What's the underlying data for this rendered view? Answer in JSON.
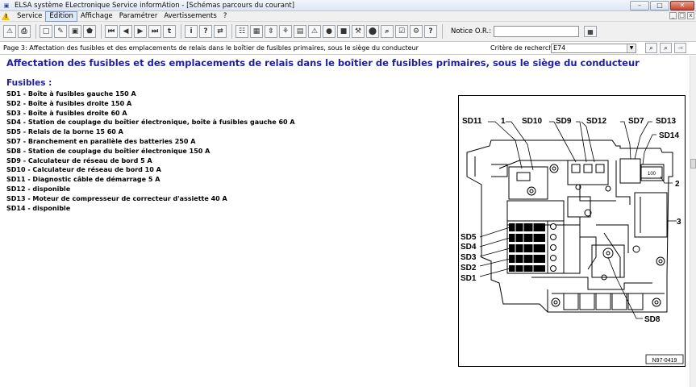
{
  "window": {
    "title": "ELSA système ELectronique Service informAtion - [Schémas parcours du courant]",
    "buttons": {
      "minimize": "–",
      "maximize": "□",
      "close": "✕"
    }
  },
  "menu": {
    "items": [
      "Service",
      "Edition",
      "Affichage",
      "Paramétrer",
      "Avertissements",
      "?"
    ],
    "active_index": 1,
    "mdi_buttons": [
      "_",
      "□",
      "x"
    ]
  },
  "toolbar": {
    "icons": [
      "exit-icon",
      "print-icon",
      "document-icon",
      "edit-icon",
      "photo-icon",
      "car-icon",
      "first-page-icon",
      "previous-page-icon",
      "next-page-icon",
      "last-page-icon",
      "back-link-icon",
      "info-icon",
      "help-icon",
      "swap-icon",
      "notes-icon",
      "grid-icon",
      "sort-icon",
      "diagnostic-icon",
      "table-icon",
      "warning-icon",
      "globe-icon",
      "save-icon",
      "wrench-icon",
      "vehicle-icon",
      "search-doc-icon",
      "checklist-icon",
      "tools-icon",
      "question-icon"
    ],
    "glyphs": [
      "⚠",
      "⎙",
      "□",
      "✎",
      "▣",
      "⬟",
      "⏮",
      "◀",
      "▶",
      "⏭",
      "t",
      "i",
      "?",
      "⇄",
      "☷",
      "▦",
      "⇳",
      "⚘",
      "▤",
      "⚠",
      "●",
      "■",
      "⚒",
      "⬤",
      "⌕",
      "☑",
      "⚙",
      "?"
    ],
    "notice_label": "Notice O.R.:",
    "notice_value": ""
  },
  "pagebar": {
    "page_label": "Page 3: Affectation des fusibles et des emplacements de relais dans le boîtier de fusibles primaires, sous le siège du conducteur",
    "criteria_label": "Critère de recherche:",
    "criteria_value": "E74"
  },
  "document": {
    "heading": "Affectation des fusibles et des emplacements de relais dans le boîtier de fusibles primaires, sous le siège du conducteur",
    "section_title": "Fusibles :",
    "fuses": [
      "SD1 - Boîte à fusibles gauche 150 A",
      "SD2 - Boîte à fusibles droite 150 A",
      "SD3 - Boîte à fusibles droite 60 A",
      "SD4 - Station de couplage du boîtier électronique, boîte à fusibles gauche 60 A",
      "SD5 - Relais de la borne 15 60 A",
      "SD7 - Branchement en parallèle des batteries 250 A",
      "SD8 - Station de couplage du boîtier électronique 150 A",
      "SD9 - Calculateur de réseau de bord 5 A",
      "SD10 - Calculateur de réseau de bord 10 A",
      "SD11 - Diagnostic câble de démarrage 5 A",
      "SD12 - disponible",
      "SD13 - Moteur de compresseur de correcteur d'assiette 40 A",
      "SD14 - disponible"
    ]
  },
  "diagram": {
    "labels": {
      "sd11": "SD11",
      "one": "1",
      "sd10": "SD10",
      "sd9": "SD9",
      "sd12": "SD12",
      "sd7": "SD7",
      "sd13": "SD13",
      "sd14": "SD14",
      "two": "2",
      "three": "3",
      "sd5": "SD5",
      "sd4": "SD4",
      "sd3": "SD3",
      "sd2": "SD2",
      "sd1": "SD1",
      "sd8": "SD8",
      "relay_value": "100"
    },
    "reference": "N97-0419"
  }
}
